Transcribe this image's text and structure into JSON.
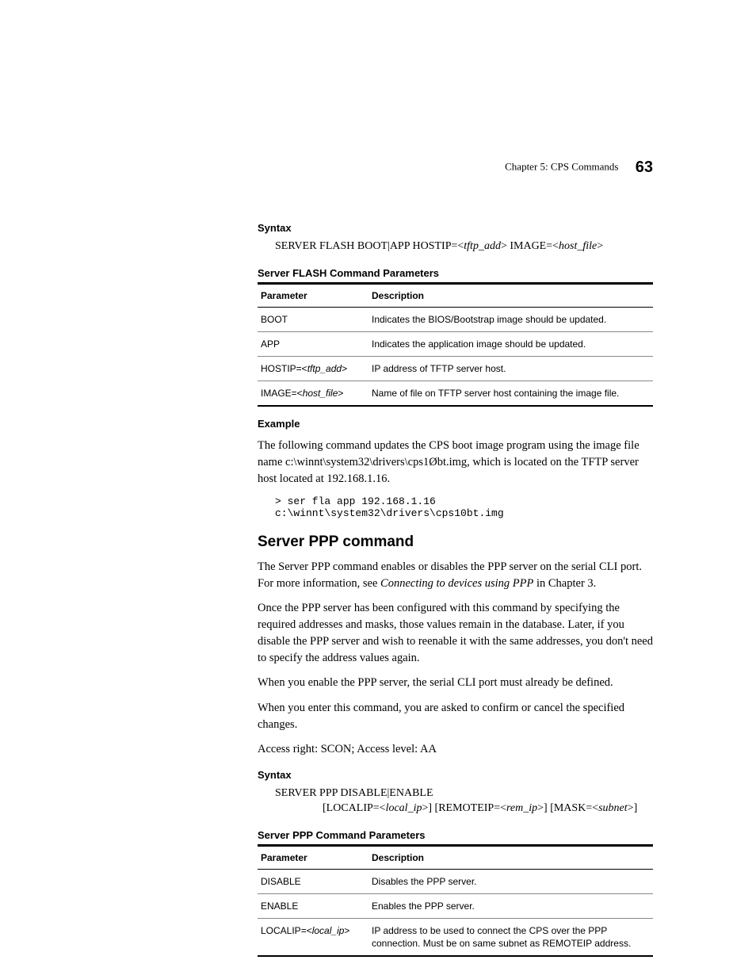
{
  "header": {
    "chapter": "Chapter 5: CPS Commands",
    "pagenum": "63"
  },
  "syntax1": {
    "label": "Syntax",
    "prefix": "SERVER FLASH BOOT|APP HOSTIP=<",
    "arg1": "tftp_add",
    "mid": "> IMAGE=<",
    "arg2": "host_file",
    "suffix": ">"
  },
  "table1": {
    "title": "Server FLASH Command Parameters",
    "head_param": "Parameter",
    "head_desc": "Description",
    "rows": [
      {
        "param": "BOOT",
        "desc": "Indicates the BIOS/Bootstrap image should be updated."
      },
      {
        "param_pre": "APP",
        "desc": "Indicates the application image should be updated."
      },
      {
        "param_pre": "HOSTIP=<",
        "param_it": "tftp_add",
        "param_post": ">",
        "desc": "IP address of TFTP server host."
      },
      {
        "param_pre": "IMAGE=<",
        "param_it": "host_file",
        "param_post": ">",
        "desc": "Name of file on TFTP server host containing the image file."
      }
    ]
  },
  "example": {
    "label": "Example",
    "text": "The following command updates the CPS boot image program using the image file name c:\\winnt\\system32\\drivers\\cps1Øbt.img, which is located on the TFTP server host located at 192.168.1.16.",
    "code": "> ser fla app 192.168.1.16 c:\\winnt\\system32\\drivers\\cps10bt.img"
  },
  "section_heading": "Server PPP command",
  "para1a": "The Server PPP command enables or disables the PPP server on the serial CLI port. For more information, see ",
  "para1it": "Connecting to devices using PPP",
  "para1b": " in Chapter 3.",
  "para2": "Once the PPP server has been configured with this command by specifying the required addresses and masks, those values remain in the database. Later, if you disable the PPP server and wish to reenable it with the same addresses, you don't need to specify the address values again.",
  "para3": "When you enable the PPP server, the serial CLI port must already be defined.",
  "para4": "When you enter this command, you are asked to confirm or cancel the specified changes.",
  "para5": "Access right: SCON; Access level: AA",
  "syntax2": {
    "label": "Syntax",
    "line1": "SERVER PPP DISABLE|ENABLE",
    "l2a": "[LOCALIP=<",
    "l2i1": "local_ip",
    "l2b": ">] [REMOTEIP=<",
    "l2i2": "rem_ip",
    "l2c": ">] [MASK=<",
    "l2i3": "subnet",
    "l2d": ">]"
  },
  "table2": {
    "title": "Server PPP Command Parameters",
    "head_param": "Parameter",
    "head_desc": "Description",
    "rows": [
      {
        "param": "DISABLE",
        "desc": "Disables the PPP server."
      },
      {
        "param": "ENABLE",
        "desc": "Enables the PPP server."
      },
      {
        "param_pre": "LOCALIP=<",
        "param_it": "local_ip",
        "param_post": ">",
        "desc": "IP address to be used to connect the CPS over the PPP connection. Must be on same subnet as REMOTEIP address."
      }
    ]
  }
}
